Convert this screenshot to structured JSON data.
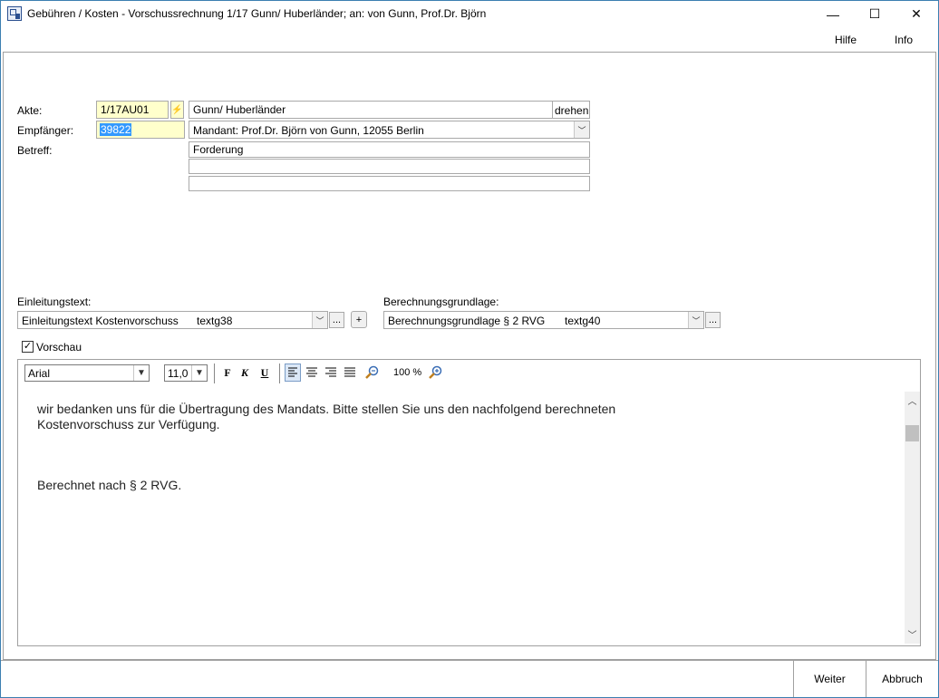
{
  "window": {
    "title": "Gebühren / Kosten - Vorschussrechnung 1/17 Gunn/ Huberländer; an: von Gunn, Prof.Dr. Björn",
    "minimize": "—",
    "maximize": "☐",
    "close": "✕"
  },
  "menu": {
    "help": "Hilfe",
    "info": "Info"
  },
  "form": {
    "akte_label": "Akte:",
    "akte_value": "1/17AU01",
    "akte_name": "Gunn/ Huberländer",
    "drehen": "drehen",
    "empfaenger_label": "Empfänger:",
    "empfaenger_value": "39822",
    "empfaenger_name": "Mandant: Prof.Dr. Björn von Gunn, 12055 Berlin",
    "betreff_label": "Betreff:",
    "betreff_1": "Forderung",
    "betreff_2": "",
    "betreff_3": ""
  },
  "texts": {
    "einleitung_label": "Einleitungstext:",
    "einleitung_value": "Einleitungstext Kostenvorschuss",
    "einleitung_code": "textg38",
    "berechnung_label": "Berechnungsgrundlage:",
    "berechnung_value": "Berechnungsgrundlage § 2 RVG",
    "berechnung_code": "textg40",
    "ellipsis": "...",
    "plus": "+"
  },
  "preview": {
    "label": "Vorschau",
    "checked": true
  },
  "editor": {
    "font": "Arial",
    "size": "11,0",
    "bold": "F",
    "italic": "K",
    "underline": "U",
    "zoom": "100 %",
    "line1": "wir bedanken uns für die Übertragung des Mandats. Bitte stellen Sie uns den nachfolgend berechneten",
    "line2": "Kostenvorschuss zur Verfügung.",
    "line3": "Berechnet nach § 2 RVG."
  },
  "buttons": {
    "weiter": "Weiter",
    "abbruch": "Abbruch"
  },
  "icons": {
    "app": "app-document-icon",
    "zoom_out": "zoom-out-icon",
    "zoom_in": "zoom-in-icon",
    "chevron": "chevron-down-icon"
  },
  "colors": {
    "field_yellow": "#ffffcc",
    "selection": "#3399ff",
    "border": "#a9a9a9"
  }
}
